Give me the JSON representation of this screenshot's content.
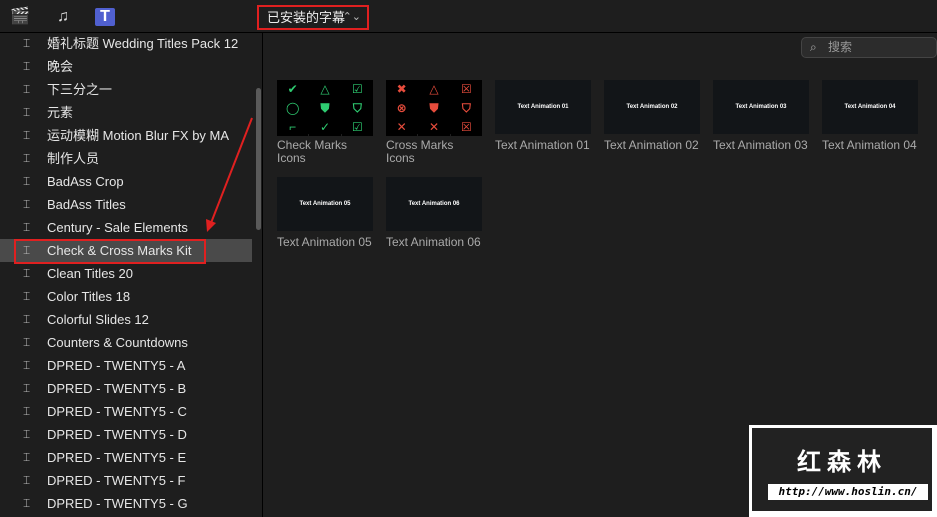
{
  "toolbar": {
    "icons": [
      "clapper-star-icon",
      "music-photo-icon",
      "titles-icon"
    ],
    "selector": "已安装的字幕"
  },
  "search": {
    "placeholder": "搜索"
  },
  "sidebar": {
    "selected_index": 9,
    "items": [
      "婚礼标题 Wedding Titles Pack 12",
      "晚会",
      "下三分之一",
      "元素",
      "运动模糊 Motion Blur FX by MA",
      "制作人员",
      "BadAss Crop",
      "BadAss Titles",
      "Century - Sale Elements",
      "Check & Cross Marks Kit",
      "Clean Titles 20",
      "Color Titles 18",
      "Colorful Slides 12",
      "Counters & Countdowns",
      "DPRED - TWENTY5 - A",
      "DPRED - TWENTY5 - B",
      "DPRED - TWENTY5 - C",
      "DPRED - TWENTY5 - D",
      "DPRED - TWENTY5 - E",
      "DPRED - TWENTY5 - F",
      "DPRED - TWENTY5 - G"
    ]
  },
  "tiles": [
    {
      "caption": "Check Marks Icons",
      "type": "check",
      "colors": "#2ecc71"
    },
    {
      "caption": "Cross Marks Icons",
      "type": "cross",
      "colors": "#e74c3c"
    },
    {
      "caption": "Text Animation 01",
      "thumb": "Text Animation 01"
    },
    {
      "caption": "Text Animation 02",
      "thumb": "Text Animation 02"
    },
    {
      "caption": "Text Animation 03",
      "thumb": "Text Animation 03"
    },
    {
      "caption": "Text Animation 04",
      "thumb": "Text Animation 04"
    },
    {
      "caption": "Text Animation 05",
      "thumb": "Text Animation 05"
    },
    {
      "caption": "Text Animation 06",
      "thumb": "Text Animation 06"
    }
  ],
  "watermark": {
    "title": "红森林",
    "url": "http://www.hoslin.cn/"
  }
}
